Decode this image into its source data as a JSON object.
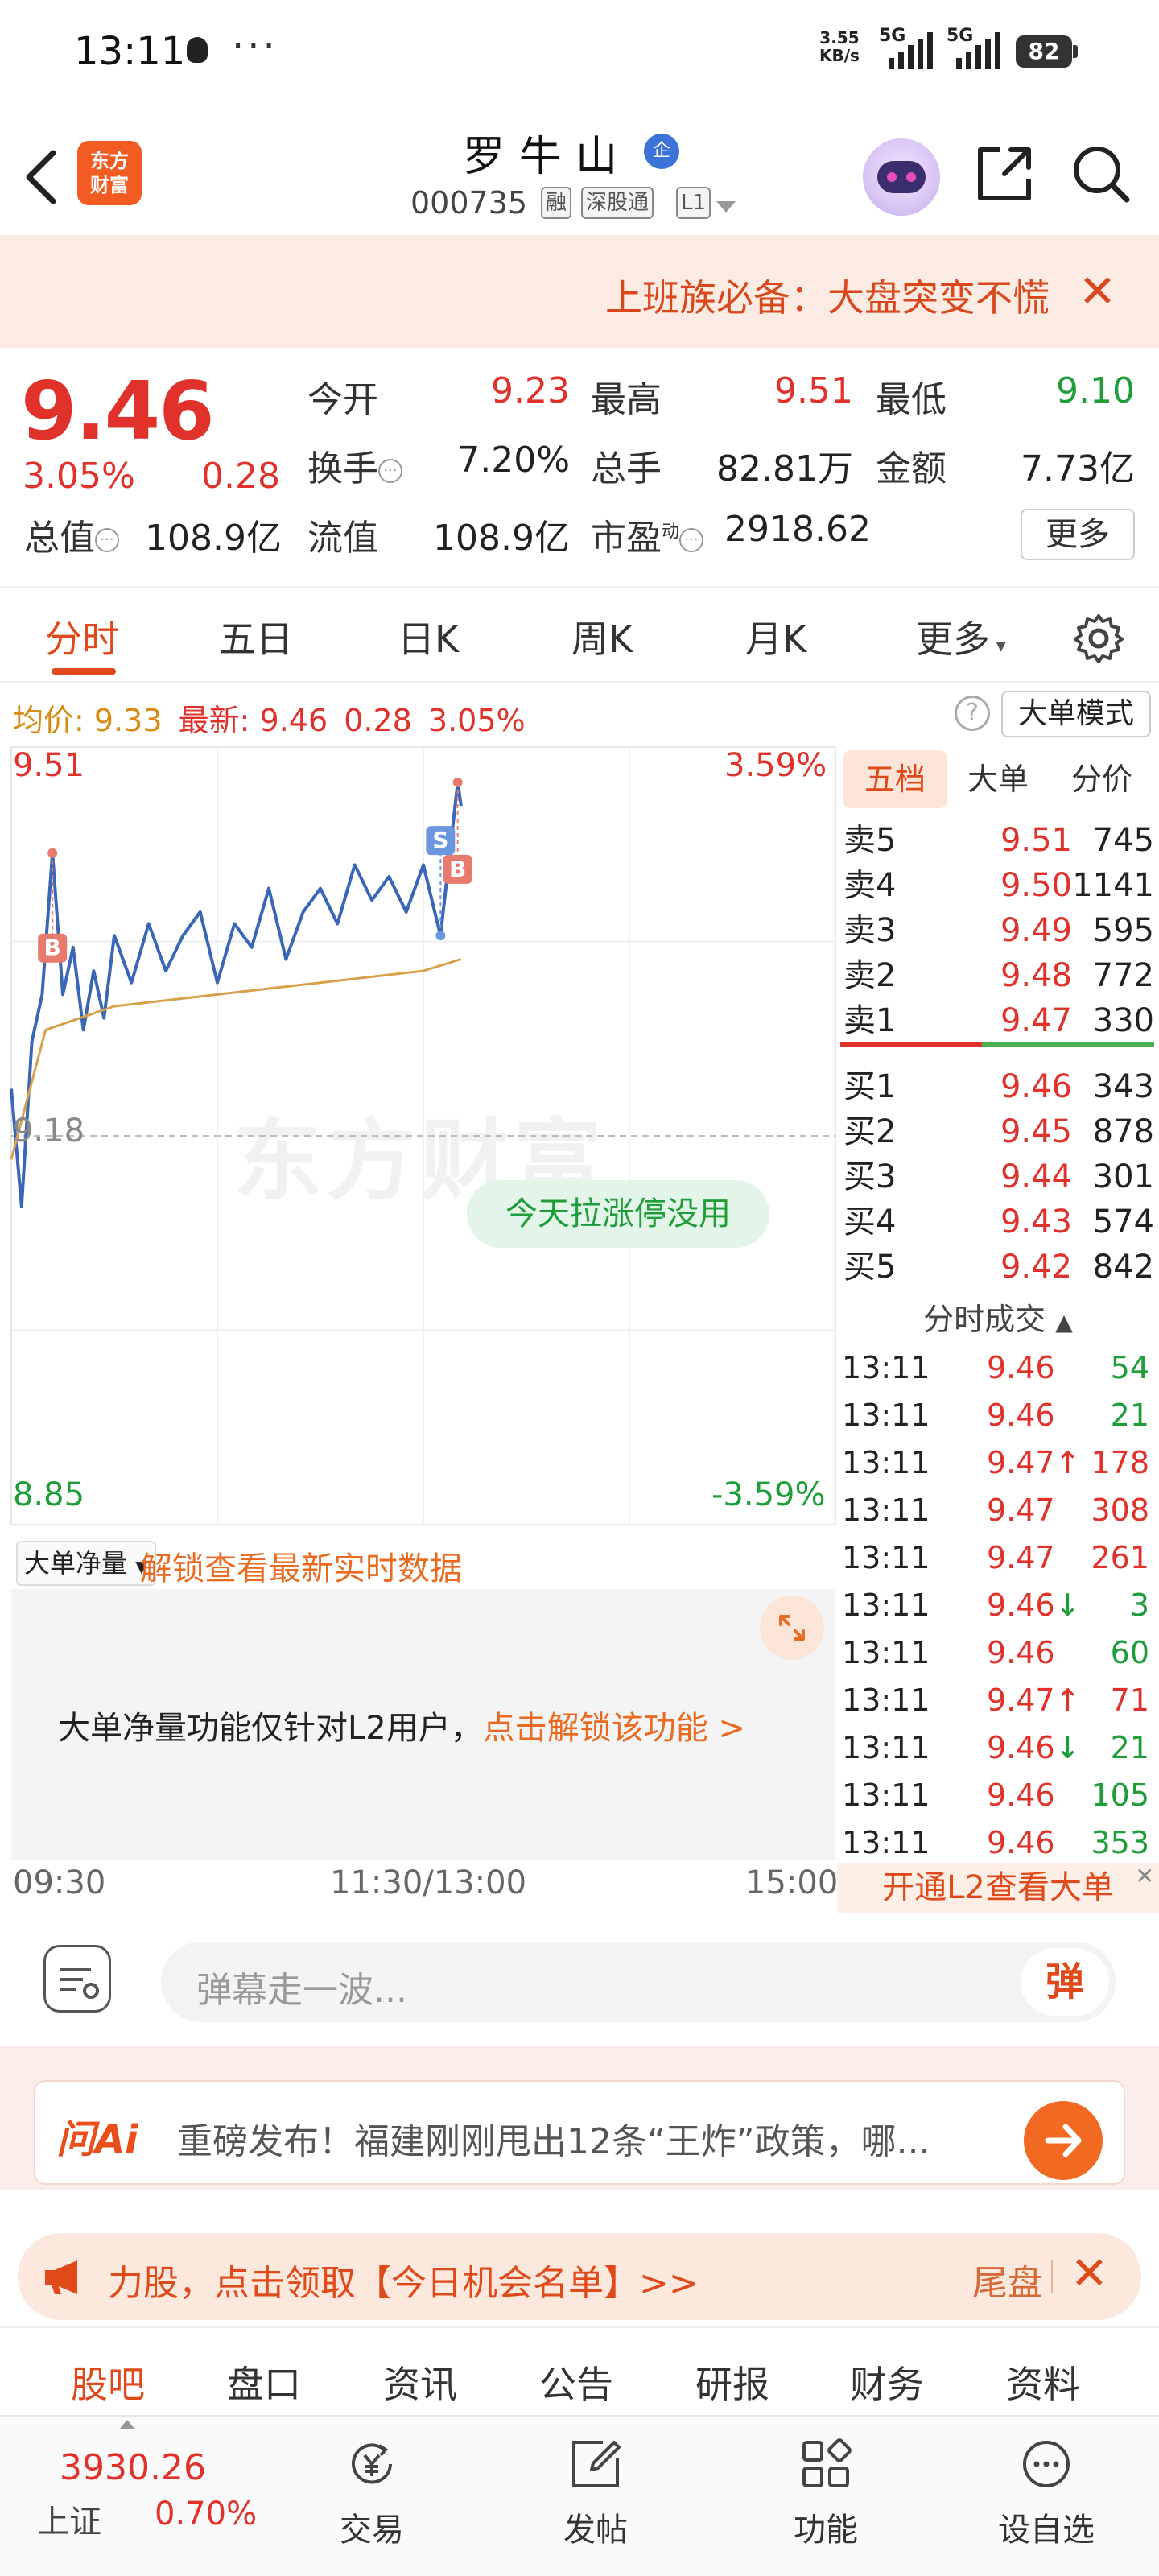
{
  "status_bar": {
    "time": "13:11",
    "dots": "···",
    "net_speed_value": "3.55",
    "net_speed_unit": "KB/s",
    "sim1": "5G",
    "sim2": "5G",
    "battery": "82"
  },
  "header": {
    "logo_line1": "东方",
    "logo_line2": "财富",
    "stock_name": "罗牛山",
    "verified_badge": "企",
    "stock_code": "000735",
    "tags": [
      "融",
      "深股通",
      "L1"
    ]
  },
  "banner": {
    "text": "上班族必备：大盘突变不慌",
    "close": "✕"
  },
  "quote": {
    "price": "9.46",
    "change_pct": "3.05%",
    "change_abs": "0.28",
    "fields": [
      {
        "label": "今开",
        "value": "9.23",
        "color": "#e0312b"
      },
      {
        "label": "最高",
        "value": "9.51",
        "color": "#e0312b"
      },
      {
        "label": "最低",
        "value": "9.10",
        "color": "#1f9d3a"
      },
      {
        "label": "换手",
        "value": "7.20%",
        "color": "#222222"
      },
      {
        "label": "总手",
        "value": "82.81万",
        "color": "#222222"
      },
      {
        "label": "金额",
        "value": "7.73亿",
        "color": "#222222"
      },
      {
        "label": "总值",
        "value": "108.9亿",
        "color": "#222222"
      },
      {
        "label": "流值",
        "value": "108.9亿",
        "color": "#222222"
      },
      {
        "label": "市盈",
        "label_sup": "动",
        "value": "2918.62",
        "color": "#222222"
      }
    ],
    "more_label": "更多"
  },
  "tabs": {
    "items": [
      "分时",
      "五日",
      "日K",
      "周K",
      "月K",
      "更多"
    ],
    "active": 0
  },
  "avg_line": {
    "avg_label": "均价:",
    "avg_value": "9.33",
    "latest_label": "最新:",
    "latest_value": "9.46",
    "latest_change": "0.28",
    "latest_pct": "3.05%",
    "big_order_mode": "大单模式"
  },
  "chart": {
    "y_top": "9.51",
    "y_mid": "9.18",
    "y_bottom": "8.85",
    "pct_top": "3.59%",
    "pct_bottom": "-3.59%",
    "watermark": "东方财富",
    "hint": "今天拉涨停没用",
    "marker_buy": "B",
    "marker_sell": "S",
    "x_labels": [
      "09:30",
      "11:30/13:00",
      "15:00"
    ]
  },
  "chart_data": {
    "type": "line",
    "ylim": [
      8.85,
      9.51
    ],
    "series": [
      {
        "name": "",
        "x": [
          "09:30",
          "09:33",
          "09:36",
          "09:39",
          "09:42",
          "09:45",
          "09:48",
          "09:51",
          "09:54",
          "09:57",
          "10:00",
          "10:05",
          "10:10",
          "10:15",
          "10:20",
          "10:25",
          "10:30",
          "10:35",
          "10:40",
          "10:45",
          "10:50",
          "10:55",
          "11:00",
          "11:05",
          "11:10",
          "11:15",
          "11:20",
          "11:25",
          "11:30",
          "13:05",
          "13:10",
          "13:11"
        ],
        "values": [
          9.22,
          9.12,
          9.26,
          9.3,
          9.42,
          9.3,
          9.34,
          9.27,
          9.32,
          9.28,
          9.35,
          9.31,
          9.36,
          9.32,
          9.35,
          9.37,
          9.31,
          9.36,
          9.34,
          9.39,
          9.33,
          9.37,
          9.39,
          9.36,
          9.41,
          9.38,
          9.4,
          9.37,
          9.41,
          9.35,
          9.48,
          9.46
        ]
      },
      {
        "name": "",
        "x": [
          "09:30",
          "09:40",
          "10:00",
          "10:30",
          "11:00",
          "11:30",
          "13:11"
        ],
        "values": [
          9.16,
          9.27,
          9.29,
          9.3,
          9.31,
          9.32,
          9.33
        ]
      }
    ]
  },
  "net_panel": {
    "dropdown": "大单净量",
    "unlock_link": "解锁查看最新实时数据",
    "msg_main": "大单净量功能仅针对L2用户，",
    "msg_link": "点击解锁该功能 >"
  },
  "order_book": {
    "tabs": [
      "五档",
      "大单",
      "分价"
    ],
    "asks": [
      {
        "name": "卖5",
        "price": "9.51",
        "vol": "745"
      },
      {
        "name": "卖4",
        "price": "9.50",
        "vol": "1141"
      },
      {
        "name": "卖3",
        "price": "9.49",
        "vol": "595"
      },
      {
        "name": "卖2",
        "price": "9.48",
        "vol": "772"
      },
      {
        "name": "卖1",
        "price": "9.47",
        "vol": "330"
      }
    ],
    "bids": [
      {
        "name": "买1",
        "price": "9.46",
        "vol": "343"
      },
      {
        "name": "买2",
        "price": "9.45",
        "vol": "878"
      },
      {
        "name": "买3",
        "price": "9.44",
        "vol": "301"
      },
      {
        "name": "买4",
        "price": "9.43",
        "vol": "574"
      },
      {
        "name": "买5",
        "price": "9.42",
        "vol": "842"
      }
    ],
    "ticks_title": "分时成交",
    "ticks": [
      {
        "time": "13:11",
        "price": "9.46",
        "dir": "",
        "vol": "54",
        "vol_color": "#1f9d3a"
      },
      {
        "time": "13:11",
        "price": "9.46",
        "dir": "",
        "vol": "21",
        "vol_color": "#1f9d3a"
      },
      {
        "time": "13:11",
        "price": "9.47",
        "dir": "↑",
        "vol": "178",
        "vol_color": "#e0312b"
      },
      {
        "time": "13:11",
        "price": "9.47",
        "dir": "",
        "vol": "308",
        "vol_color": "#e0312b"
      },
      {
        "time": "13:11",
        "price": "9.47",
        "dir": "",
        "vol": "261",
        "vol_color": "#e0312b"
      },
      {
        "time": "13:11",
        "price": "9.46",
        "dir": "↓",
        "vol": "3",
        "vol_color": "#1f9d3a"
      },
      {
        "time": "13:11",
        "price": "9.46",
        "dir": "",
        "vol": "60",
        "vol_color": "#1f9d3a"
      },
      {
        "time": "13:11",
        "price": "9.47",
        "dir": "↑",
        "vol": "71",
        "vol_color": "#e0312b"
      },
      {
        "time": "13:11",
        "price": "9.46",
        "dir": "↓",
        "vol": "21",
        "vol_color": "#1f9d3a"
      },
      {
        "time": "13:11",
        "price": "9.46",
        "dir": "",
        "vol": "105",
        "vol_color": "#1f9d3a"
      },
      {
        "time": "13:11",
        "price": "9.46",
        "dir": "",
        "vol": "353",
        "vol_color": "#1f9d3a"
      }
    ],
    "l2_open": "开通L2查看大单"
  },
  "comment_bar": {
    "placeholder": "弹幕走一波...",
    "danmu_btn": "弹"
  },
  "ai_banner": {
    "logo": "问Ai",
    "text": "重磅发布！福建刚刚甩出12条“王炸”政策，哪..."
  },
  "promo": {
    "text": "力股，点击领取【今日机会名单】>>",
    "tail": "尾盘",
    "close": "✕"
  },
  "section_nav": {
    "items": [
      "股吧",
      "盘口",
      "资讯",
      "公告",
      "研报",
      "财务",
      "资料"
    ],
    "active": 0
  },
  "bottom_bar": {
    "index_value": "3930.26",
    "index_name": "上证",
    "index_pct": "0.70%",
    "items": [
      "交易",
      "发帖",
      "功能",
      "设自选"
    ]
  },
  "colors": {
    "up": "#e0312b",
    "down": "#1f9d3a",
    "accent": "#e04a1b",
    "price_line": "#3a66b8",
    "avg_line": "#d9a04a"
  }
}
